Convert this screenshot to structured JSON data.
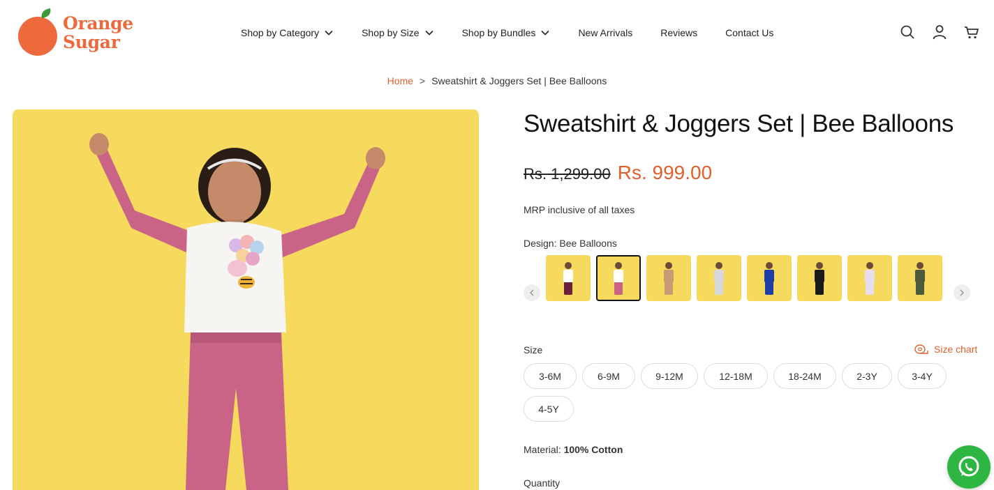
{
  "brand": {
    "line1": "Orange",
    "line2": "Sugar"
  },
  "nav": {
    "items": [
      {
        "label": "Shop by Category",
        "has_dropdown": true
      },
      {
        "label": "Shop by Size",
        "has_dropdown": true
      },
      {
        "label": "Shop by Bundles",
        "has_dropdown": true
      },
      {
        "label": "New Arrivals",
        "has_dropdown": false
      },
      {
        "label": "Reviews",
        "has_dropdown": false
      },
      {
        "label": "Contact Us",
        "has_dropdown": false
      }
    ]
  },
  "header_icons": [
    "search-icon",
    "account-icon",
    "cart-icon"
  ],
  "breadcrumb": {
    "home": "Home",
    "separator": ">",
    "current": "Sweatshirt & Joggers Set | Bee Balloons"
  },
  "product": {
    "title": "Sweatshirt & Joggers Set | Bee Balloons",
    "old_price": "Rs. 1,299.00",
    "new_price": "Rs. 999.00",
    "tax_note": "MRP inclusive of all taxes",
    "design_label": "Design: Bee Balloons",
    "swatches": [
      {
        "top": "#ffffff",
        "bottom": "#6b1f3a",
        "selected": false
      },
      {
        "top": "#ffffff",
        "bottom": "#c96487",
        "selected": true
      },
      {
        "top": "#c99a73",
        "bottom": "#c99a73",
        "selected": false
      },
      {
        "top": "#d8d8dc",
        "bottom": "#d8d8dc",
        "selected": false
      },
      {
        "top": "#1e3fa8",
        "bottom": "#1e3fa8",
        "selected": false
      },
      {
        "top": "#1a1a1a",
        "bottom": "#1a1a1a",
        "selected": false
      },
      {
        "top": "#e6ddee",
        "bottom": "#e6ddee",
        "selected": false
      },
      {
        "top": "#4b5a3c",
        "bottom": "#4b5a3c",
        "selected": false
      }
    ],
    "size_label": "Size",
    "size_chart_label": "Size chart",
    "sizes": [
      "3-6M",
      "6-9M",
      "9-12M",
      "12-18M",
      "18-24M",
      "2-3Y",
      "3-4Y",
      "4-5Y"
    ],
    "material_label": "Material:",
    "material_value": "100% Cotton",
    "quantity_label": "Quantity"
  },
  "colors": {
    "accent": "#e0602b",
    "image_bg": "#f5da5e",
    "whatsapp": "#2db742"
  }
}
